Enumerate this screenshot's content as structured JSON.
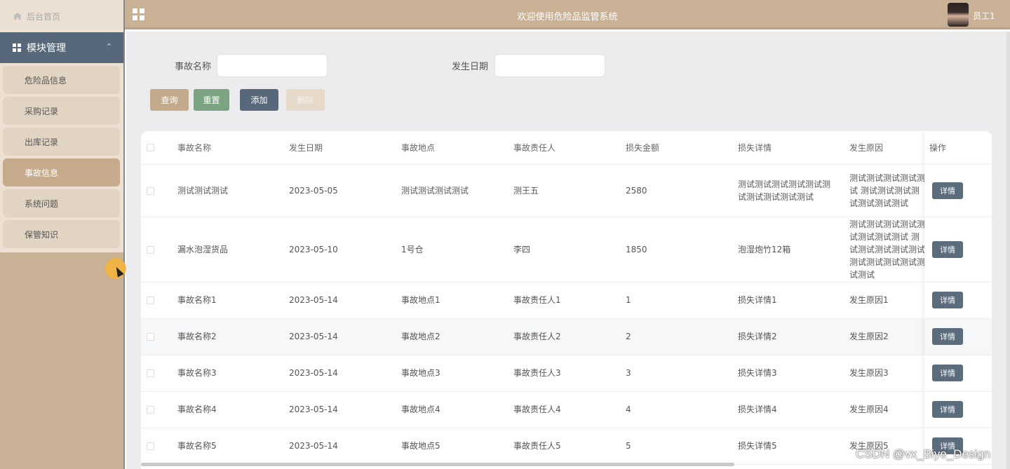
{
  "sidebar": {
    "home": "后台首页",
    "module": "模块管理",
    "items": [
      {
        "label": "危险品信息"
      },
      {
        "label": "采购记录"
      },
      {
        "label": "出库记录"
      },
      {
        "label": "事故信息"
      },
      {
        "label": "系统问题"
      },
      {
        "label": "保管知识"
      }
    ]
  },
  "header": {
    "title": "欢迎使用危险品监管系统",
    "user": "员工1"
  },
  "search": {
    "name_label": "事故名称",
    "date_label": "发生日期",
    "name_value": "",
    "date_value": ""
  },
  "buttons": {
    "query": "查询",
    "reset": "重置",
    "add": "添加",
    "delete": "删除"
  },
  "table": {
    "columns": [
      "事故名称",
      "发生日期",
      "事故地点",
      "事故责任人",
      "损失金额",
      "损失详情",
      "发生原因",
      "操作"
    ],
    "rows": [
      [
        "测试测试测试",
        "2023-05-05",
        "测试测试测试测试",
        "测王五",
        "2580",
        "测试测试测试测试测试测试测试测试测试测试",
        "测试测试测试测试测试 测试测试测试测试测试测试测试"
      ],
      [
        "漏水泡湿货品",
        "2023-05-10",
        "1号仓",
        "李四",
        "1850",
        "泡湿炮竹12箱",
        "测试测试测试测试测试测试测试测试 测试测试测试测试测试 测试测试测试测试测试测试"
      ],
      [
        "事故名称1",
        "2023-05-14",
        "事故地点1",
        "事故责任人1",
        "1",
        "损失详情1",
        "发生原因1"
      ],
      [
        "事故名称2",
        "2023-05-14",
        "事故地点2",
        "事故责任人2",
        "2",
        "损失详情2",
        "发生原因2"
      ],
      [
        "事故名称3",
        "2023-05-14",
        "事故地点3",
        "事故责任人3",
        "3",
        "损失详情3",
        "发生原因3"
      ],
      [
        "事故名称4",
        "2023-05-14",
        "事故地点4",
        "事故责任人4",
        "4",
        "损失详情4",
        "发生原因4"
      ],
      [
        "事故名称5",
        "2023-05-14",
        "事故地点5",
        "事故责任人5",
        "5",
        "损失详情5",
        "发生原因5"
      ]
    ],
    "detail_label": "详情"
  },
  "watermark": "CSDN @vx_Biye_Design",
  "colors": {
    "sidebar": "#c9b195",
    "module": "#56687a",
    "active": "#c5aa8b",
    "reset": "#7ca483"
  }
}
